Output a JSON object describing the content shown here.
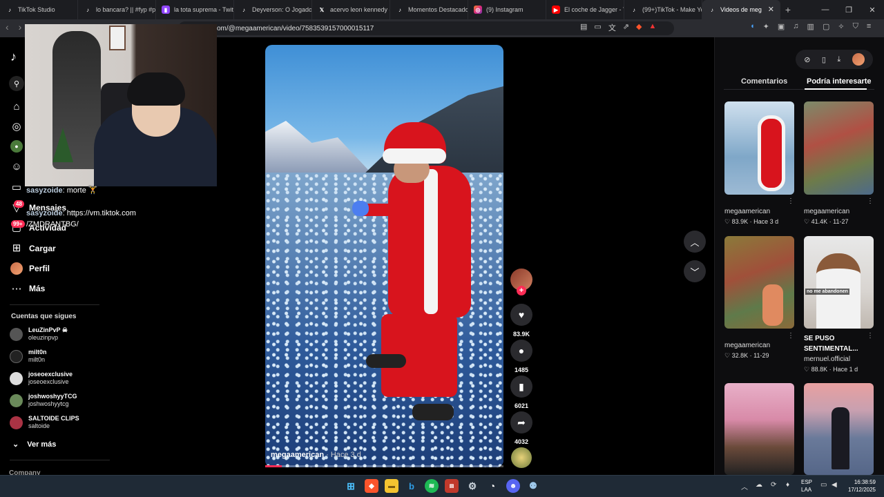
{
  "browser": {
    "tabs": [
      {
        "title": "TikTok Studio",
        "icon": "tiktok-icon"
      },
      {
        "title": "lo bancara? || #fyp #pa",
        "icon": "tiktok-icon"
      },
      {
        "title": "la tota suprema - Twitc",
        "icon": "twitch-icon"
      },
      {
        "title": "Deyverson: O Jogador",
        "icon": "tiktok-icon"
      },
      {
        "title": "acervo leon kennedy e",
        "icon": "x-icon"
      },
      {
        "title": "Momentos Destacados",
        "icon": "tiktok-icon"
      },
      {
        "title": "(9) Instagram",
        "icon": "instagram-icon"
      },
      {
        "title": "El coche de Jagger - Yo",
        "icon": "youtube-icon"
      },
      {
        "title": "(99+)TikTok - Make Yo",
        "icon": "tiktok-icon"
      },
      {
        "title": "Videos de meg",
        "icon": "tiktok-icon",
        "active": true
      }
    ],
    "url": "om/@megaamerican/video/7583539157000015117",
    "shield_count": "1"
  },
  "stream_chat": [
    {
      "user": "sasyzoide",
      "text": ": morte 🏋"
    },
    {
      "user": "sasyzoide",
      "text": ": https://vm.tiktok.com"
    },
    {
      "user": "",
      "text": "/ZMDRANTBG/"
    }
  ],
  "sidebar": {
    "messages_label": "Mensajes",
    "messages_badge": "48",
    "activity_label": "Actividad",
    "activity_badge": "99+",
    "upload_label": "Cargar",
    "profile_label": "Perfil",
    "more_label": "Más",
    "following_title": "Cuentas que sigues",
    "following": [
      {
        "name": "LeuZinPvP ☠",
        "handle": "oleuzinpvp",
        "color": "#555"
      },
      {
        "name": "milt0n",
        "handle": "milt0n",
        "color": "#222"
      },
      {
        "name": "joseoexclusive",
        "handle": "joseoexclusive",
        "color": "#ddd"
      },
      {
        "name": "joshwoshyyTCG",
        "handle": "joshwoshyytcg",
        "color": "#6a8a5a"
      },
      {
        "name": "SALTOIDE CLIPS",
        "handle": "saltoide",
        "color": "#aa3344"
      }
    ],
    "see_more": "Ver más",
    "company": "Company"
  },
  "video": {
    "author": "megaamerican",
    "time": " · Hace 3 d",
    "progress": 0.07,
    "likes": "83.9K",
    "comments": "1485",
    "saves": "6021",
    "shares": "4032"
  },
  "right_panel": {
    "tab_comments": "Comentarios",
    "tab_interest": "Podría interesarte",
    "cards": [
      {
        "user": "megaamerican",
        "likes": "83.9K",
        "date": "Hace 3 d"
      },
      {
        "user": "megaamerican",
        "likes": "41.4K",
        "date": "11-27"
      },
      {
        "user": "megaamerican",
        "likes": "32.8K",
        "date": "11-29"
      },
      {
        "title": "SE PUSO SENTIMENTAL...",
        "user": "mernuel.official",
        "likes": "88.8K",
        "date": "Hace 1 d",
        "thumb_text": "no me abandonen"
      }
    ]
  },
  "taskbar": {
    "lang1": "ESP",
    "lang2": "LAA",
    "time": "16:38:59",
    "date": "17/12/2025"
  }
}
